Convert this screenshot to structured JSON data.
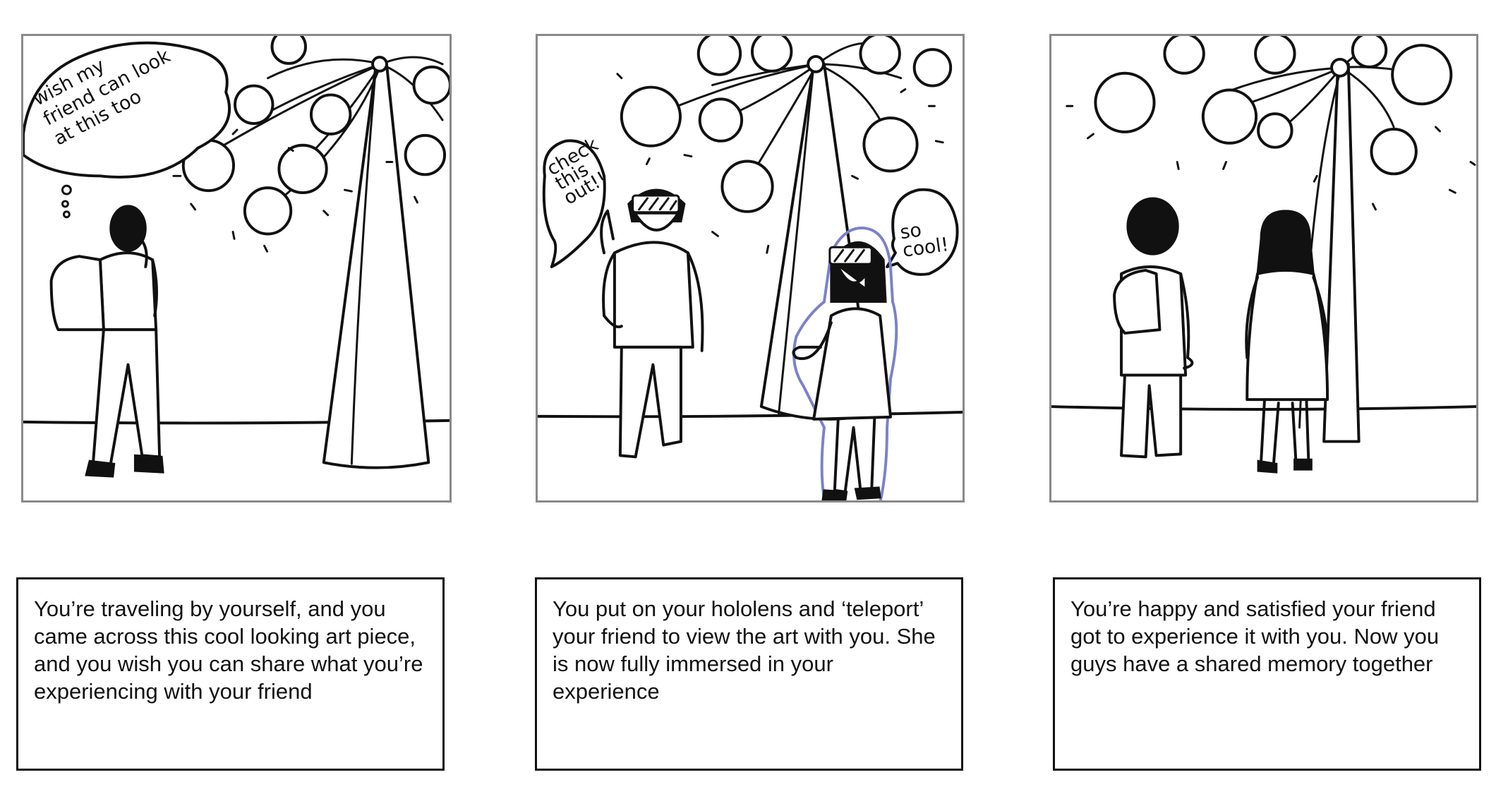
{
  "panels": [
    {
      "speech": "wish my friend can look at this too",
      "caption": "You’re traveling by yourself, and you came across this cool looking art piece, and you wish you can share what you’re experiencing with your friend"
    },
    {
      "speech_left": "check this out!!",
      "speech_right": "so cool!",
      "caption": "You put on your hololens and ‘teleport’ your friend to view the art with you. She is now fully immersed in your experience"
    },
    {
      "caption": "You’re happy and satisfied your friend got to experience it with you. Now you guys have a shared memory together"
    }
  ],
  "colors": {
    "hologram_outline": "#7b82c9",
    "panel_border": "#8a8a8a",
    "ink": "#111111"
  }
}
